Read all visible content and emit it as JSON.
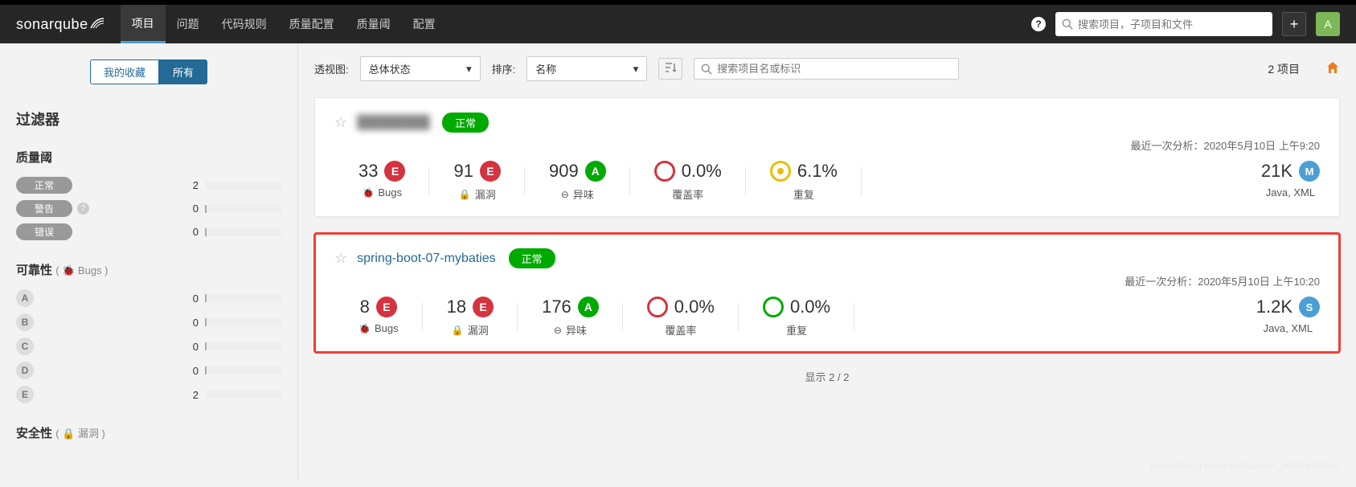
{
  "logo": {
    "part1": "sonar",
    "part2": "qube"
  },
  "nav": {
    "items": [
      "项目",
      "问题",
      "代码规则",
      "质量配置",
      "质量阈",
      "配置"
    ],
    "search_placeholder": "搜索项目，子项目和文件",
    "user_initial": "A"
  },
  "sidebar": {
    "tab_fav": "我的收藏",
    "tab_all": "所有",
    "filter_title": "过滤器",
    "quality_gate": {
      "title": "质量阈",
      "rows": [
        {
          "label": "正常",
          "count": "2",
          "bar": 100
        },
        {
          "label": "警告",
          "count": "0",
          "bar": 0,
          "help": true
        },
        {
          "label": "错误",
          "count": "0",
          "bar": 0
        }
      ]
    },
    "reliability": {
      "title": "可靠性",
      "sub": "( 🐞 Bugs )",
      "rows": [
        {
          "rating": "A",
          "count": "0",
          "bar": 0
        },
        {
          "rating": "B",
          "count": "0",
          "bar": 0
        },
        {
          "rating": "C",
          "count": "0",
          "bar": 0
        },
        {
          "rating": "D",
          "count": "0",
          "bar": 0
        },
        {
          "rating": "E",
          "count": "2",
          "bar": 100
        }
      ]
    },
    "security": {
      "title": "安全性",
      "sub": "( 🔒 漏洞 )"
    }
  },
  "content_header": {
    "perspective_label": "透视图:",
    "perspective_value": "总体状态",
    "sort_label": "排序:",
    "sort_value": "名称",
    "project_search_placeholder": "搜索项目名或标识",
    "count_text": "2 项目"
  },
  "projects": [
    {
      "name": "████████",
      "blurred": true,
      "status": "正常",
      "analysis_label": "最近一次分析：",
      "analysis_time": "2020年5月10日 上午9:20",
      "metrics": {
        "bugs": {
          "value": "33",
          "rating": "E",
          "label": "Bugs",
          "icon": "🐞"
        },
        "vuln": {
          "value": "91",
          "rating": "E",
          "label": "漏洞",
          "icon": "🔒"
        },
        "smells": {
          "value": "909",
          "rating": "A",
          "label": "异味",
          "icon": "⊖"
        },
        "coverage": {
          "value": "0.0%",
          "circle": "red",
          "label": "覆盖率"
        },
        "dup": {
          "value": "6.1%",
          "circle": "yellow",
          "label": "重复"
        },
        "size": {
          "value": "21K",
          "badge": "M",
          "label": "Java, XML"
        }
      }
    },
    {
      "name": "spring-boot-07-mybaties",
      "highlighted": true,
      "status": "正常",
      "analysis_label": "最近一次分析：",
      "analysis_time": "2020年5月10日 上午10:20",
      "metrics": {
        "bugs": {
          "value": "8",
          "rating": "E",
          "label": "Bugs",
          "icon": "🐞"
        },
        "vuln": {
          "value": "18",
          "rating": "E",
          "label": "漏洞",
          "icon": "🔒"
        },
        "smells": {
          "value": "176",
          "rating": "A",
          "label": "异味",
          "icon": "⊖"
        },
        "coverage": {
          "value": "0.0%",
          "circle": "red",
          "label": "覆盖率"
        },
        "dup": {
          "value": "0.0%",
          "circle": "green",
          "label": "重复"
        },
        "size": {
          "value": "1.2K",
          "badge": "S",
          "label": "Java, XML"
        }
      }
    }
  ],
  "footer": "显示 2 / 2",
  "watermark": "https://blog.csdn.net/weixin_42########"
}
